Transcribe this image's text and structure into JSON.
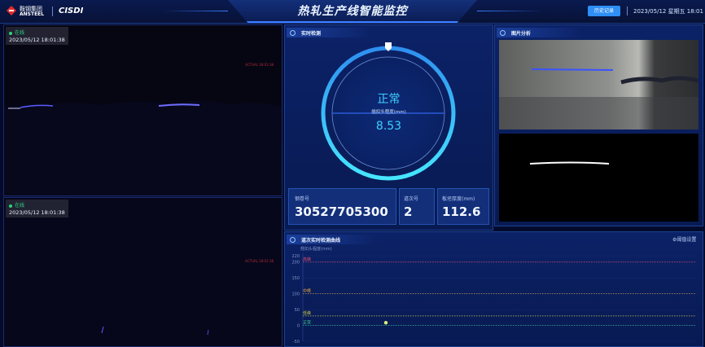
{
  "header": {
    "title": "热轧生产线智能监控",
    "brand_cn": "鞍钢集团",
    "brand_en": "ANSTEEL",
    "brand_partner": "CISDI",
    "history_button": "历史记录",
    "datetime": "2023/05/12 星期五 18:01"
  },
  "cameras": [
    {
      "status": "在线",
      "timestamp": "2023/05/12 18:01:38",
      "overlay_text": "ACTUAL 18:01:38"
    },
    {
      "status": "在线",
      "timestamp": "2023/05/12 18:01:38",
      "overlay_text": "ACTUAL 18:01:38"
    }
  ],
  "realtime": {
    "title": "实时检测",
    "status": "正常",
    "gauge_label": "翘扣头程度(mm)",
    "gauge_value": "8.53",
    "fields": [
      {
        "label": "钢卷号",
        "value": "30527705300"
      },
      {
        "label": "道次号",
        "value": "2"
      },
      {
        "label": "板坯厚度(mm)",
        "value": "112.6"
      }
    ],
    "colors": {
      "accent": "#36c6ff",
      "ok": "#3fe08d"
    }
  },
  "image_analysis": {
    "title": "图片分析"
  },
  "curve": {
    "title": "道次实时检测曲线",
    "settings_label": "阈值设置",
    "y_axis_label": "翘扣头程度(mm)"
  },
  "chart_data": {
    "type": "scatter",
    "title": "道次实时检测曲线",
    "ylabel": "翘扣头程度(mm)",
    "yticks": [
      220,
      200,
      150,
      100,
      50,
      0,
      -50
    ],
    "ylim": [
      -50,
      220
    ],
    "thresholds": [
      {
        "name": "高峰",
        "value": 200,
        "color": "#e24a6b"
      },
      {
        "name": "中峰",
        "value": 100,
        "color": "#e3a63a"
      },
      {
        "name": "低峰",
        "value": 30,
        "color": "#c7c34a"
      },
      {
        "name": "正常",
        "value": 0,
        "color": "#3fc58a"
      }
    ],
    "points": [
      {
        "x": 0,
        "y": 8.53
      }
    ]
  }
}
